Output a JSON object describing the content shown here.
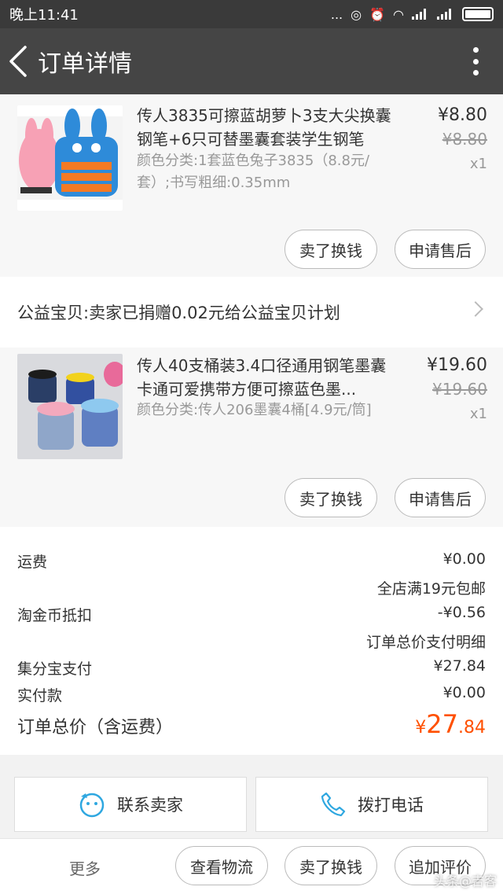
{
  "status_bar": {
    "time": "晚上11:41",
    "dots": "..."
  },
  "nav": {
    "title": "订单详情"
  },
  "items": [
    {
      "title": "传人3835可擦蓝胡萝卜3支大尖换囊钢笔+6只可替墨囊套装学生钢笔",
      "sku": "颜色分类:1套蓝色兔子3835（8.8元/套）;书写粗细:0.35mm",
      "price": "¥8.80",
      "orig_price": "¥8.80",
      "qty": "x1",
      "btn_sell": "卖了换钱",
      "btn_after": "申请售后"
    },
    {
      "title": "传人40支桶装3.4口径通用钢笔墨囊卡通可爱携带方便可擦蓝色墨...",
      "sku": "颜色分类:传人206墨囊4桶[4.9元/筒]",
      "price": "¥19.60",
      "orig_price": "¥19.60",
      "qty": "x1",
      "btn_sell": "卖了换钱",
      "btn_after": "申请售后"
    }
  ],
  "charity": {
    "text": "公益宝贝:卖家已捐赠0.02元给公益宝贝计划"
  },
  "summary": {
    "shipping_label": "运费",
    "shipping_value": "¥0.00",
    "shipping_note": "全店满19元包邮",
    "coin_label": "淘金币抵扣",
    "coin_value": "-¥0.56",
    "pay_detail_note": "订单总价支付明细",
    "jifen_label": "集分宝支付",
    "jifen_value": "¥27.84",
    "actual_label": "实付款",
    "actual_value": "¥0.00",
    "total_label": "订单总价（含运费）",
    "total_symbol": "¥",
    "total_int": "27",
    "total_dec": ".84",
    "accent_color": "#ff5000"
  },
  "contact": {
    "seller": "联系卖家",
    "phone": "拨打电话"
  },
  "bottom": {
    "more": "更多",
    "logistics": "查看物流",
    "sell": "卖了换钱",
    "review": "追加评价"
  },
  "watermark": "头条@吉客"
}
